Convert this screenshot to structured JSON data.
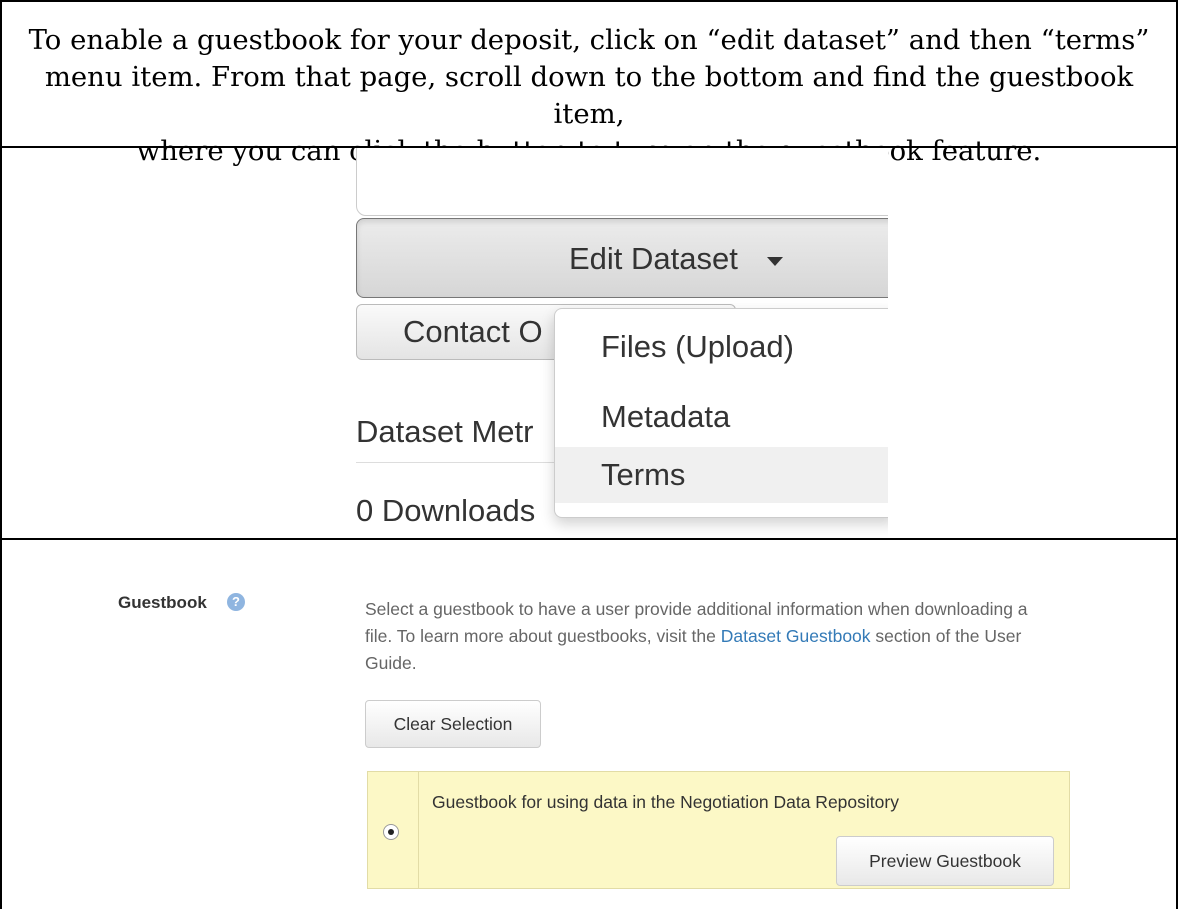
{
  "instruction": {
    "line1": "To enable a guestbook for your deposit, click on “edit dataset” and then “terms”",
    "line2": "menu item. From that page, scroll down to the bottom and find the guestbook item,",
    "line3": "where you can click the button to turn on the guestbook feature."
  },
  "dataset_panel": {
    "edit_button_label": "Edit Dataset",
    "contact_button_label": "Contact O",
    "metrics_label": "Dataset Metr",
    "downloads_label": "0 Downloads",
    "menu_items": [
      "Files (Upload)",
      "Metadata",
      "Terms"
    ],
    "active_menu_item": "Terms"
  },
  "guestbook_panel": {
    "label": "Guestbook",
    "help_icon": "question-circle-icon",
    "description_before": "Select a guestbook to have a user provide additional information when downloading a file. To learn more about guestbooks, visit the ",
    "description_link": "Dataset Guestbook",
    "description_after": " section of the User Guide.",
    "clear_button_label": "Clear Selection",
    "guestbook_name": "Guestbook for using data in the Negotiation Data Repository",
    "preview_button_label": "Preview Guestbook",
    "selected": true
  },
  "colors": {
    "link": "#337ab7",
    "row_highlight": "#fcf8c6",
    "help_icon": "#8fb5e0"
  }
}
